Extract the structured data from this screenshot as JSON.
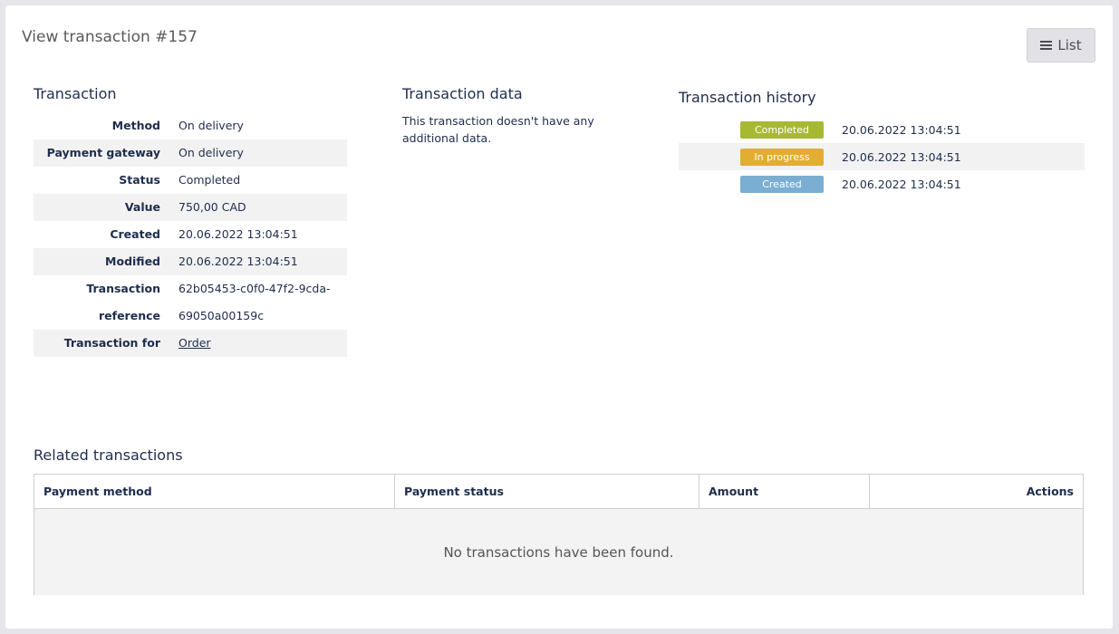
{
  "page": {
    "title": "View transaction #157",
    "list_button_label": "List"
  },
  "transaction": {
    "heading": "Transaction",
    "fields": [
      {
        "label": "Method",
        "value": "On delivery"
      },
      {
        "label": "Payment gateway",
        "value": "On delivery"
      },
      {
        "label": "Status",
        "value": "Completed"
      },
      {
        "label": "Value",
        "value": "750,00 CAD"
      },
      {
        "label": "Created",
        "value": "20.06.2022 13:04:51"
      },
      {
        "label": "Modified",
        "value": "20.06.2022 13:04:51"
      },
      {
        "label": "Transaction reference",
        "value_line1": "62b05453-c0f0-47f2-9cda-",
        "value_line2": "69050a00159c"
      },
      {
        "label": "Transaction for",
        "value": "Order"
      }
    ]
  },
  "transaction_data": {
    "heading": "Transaction data",
    "text": "This transaction doesn't have any additional data."
  },
  "history": {
    "heading": "Transaction history",
    "items": [
      {
        "status": "Completed",
        "date": "20.06.2022 13:04:51",
        "color": "#a8b832"
      },
      {
        "status": "In progress",
        "date": "20.06.2022 13:04:51",
        "color": "#e3ac33"
      },
      {
        "status": "Created",
        "date": "20.06.2022 13:04:51",
        "color": "#7aaed2"
      }
    ]
  },
  "related": {
    "heading": "Related transactions",
    "columns": [
      "Payment method",
      "Payment status",
      "Amount",
      "Actions"
    ],
    "empty_message": "No transactions have been found."
  }
}
